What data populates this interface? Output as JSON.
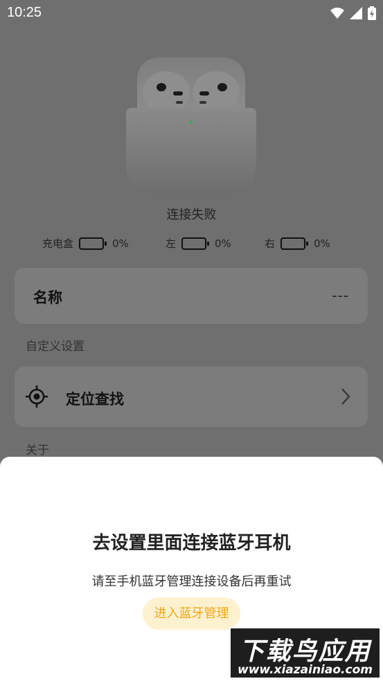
{
  "status_bar": {
    "time": "10:25"
  },
  "device": {
    "connection_status": "连接失败",
    "batteries": [
      {
        "label": "充电盒",
        "value": "0%"
      },
      {
        "label": "左",
        "value": "0%"
      },
      {
        "label": "右",
        "value": "0%"
      }
    ],
    "name_label": "名称",
    "name_value": "---"
  },
  "sections": {
    "custom_settings": "自定义设置",
    "locate_label": "定位查找",
    "about": "关于"
  },
  "dialog": {
    "title": "去设置里面连接蓝牙耳机",
    "message": "请至手机蓝牙管理连接设备后再重试",
    "button": "进入蓝牙管理"
  },
  "watermark": {
    "title": "下载鸟应用",
    "url": "www.xiazainiao.com"
  }
}
